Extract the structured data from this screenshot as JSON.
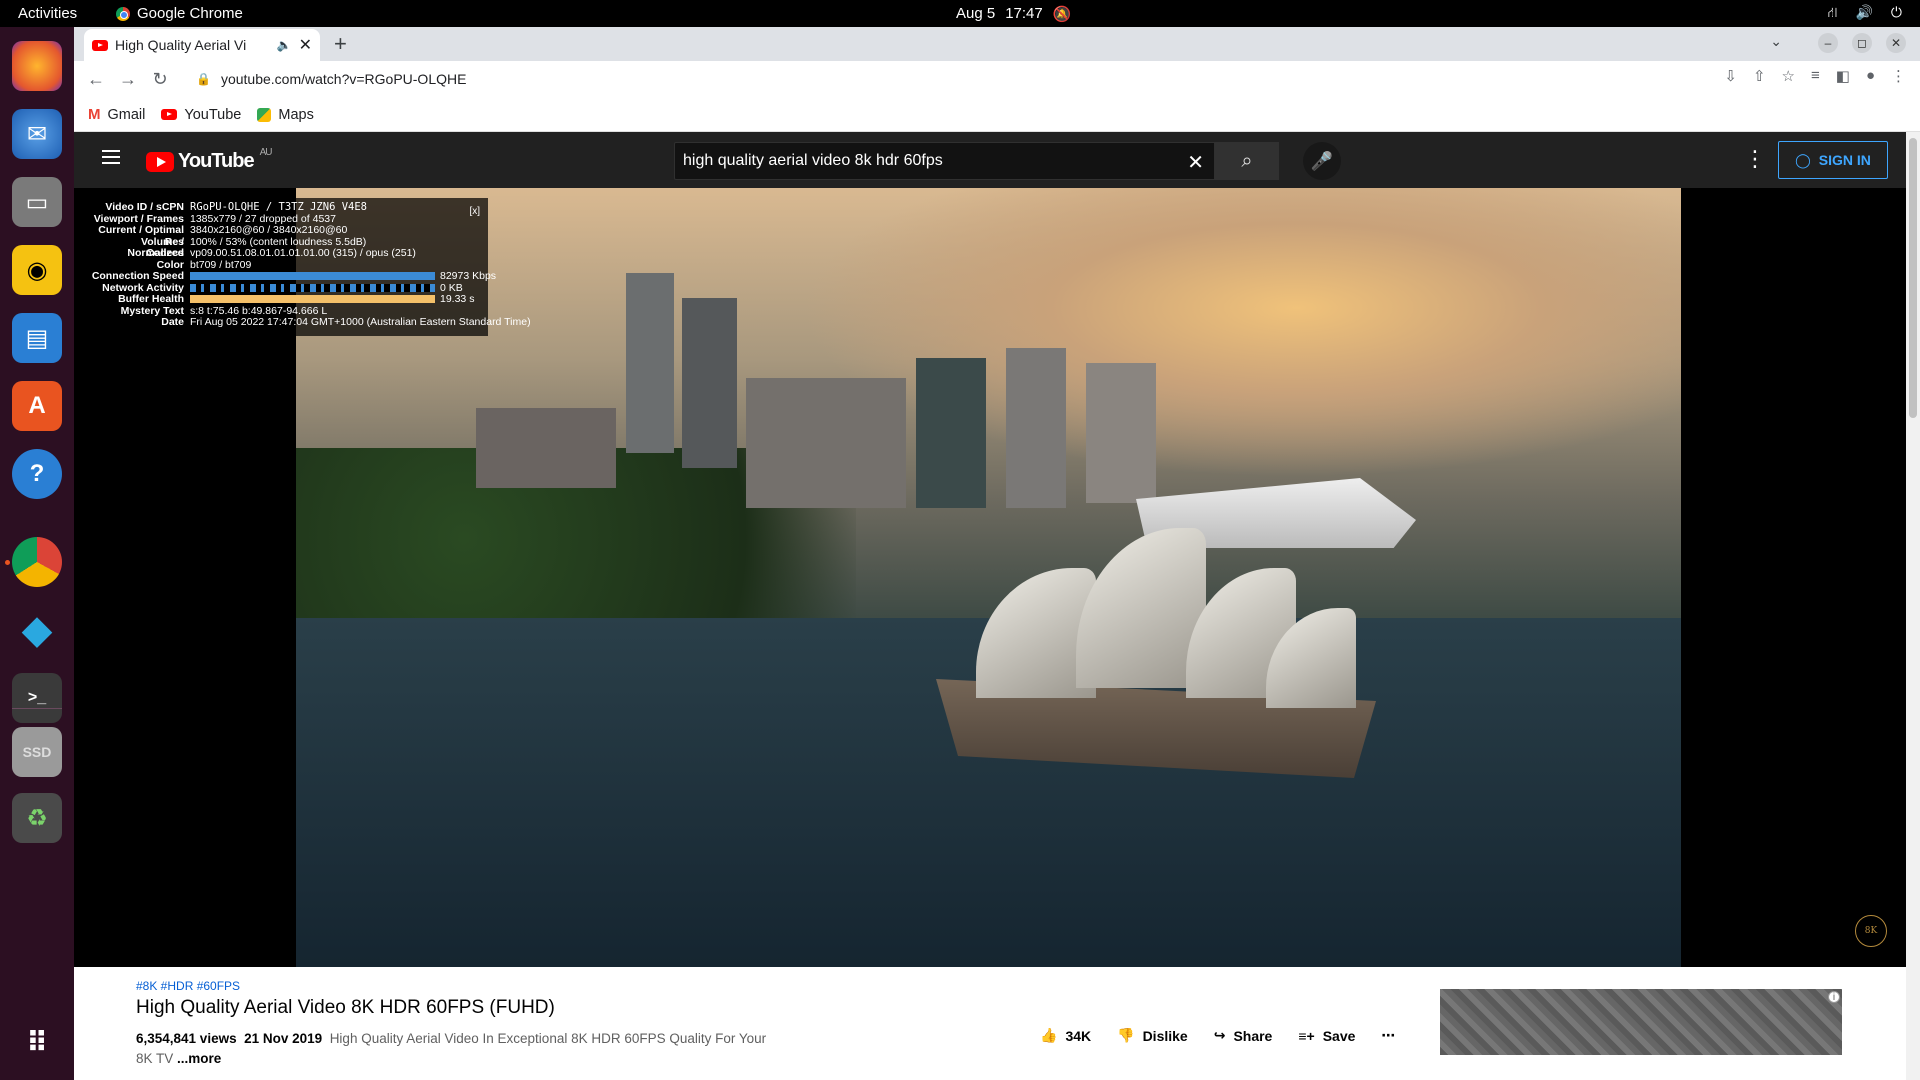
{
  "os": {
    "activities": "Activities",
    "active_app": "Google Chrome",
    "date": "Aug 5",
    "time": "17:47"
  },
  "browser": {
    "tab_title": "High Quality Aerial Vi",
    "url": "youtube.com/watch?v=RGoPU-OLQHE",
    "bookmarks": [
      "Gmail",
      "YouTube",
      "Maps"
    ]
  },
  "youtube": {
    "logo": "YouTube",
    "region": "AU",
    "search_query": "high quality aerial video 8k hdr 60fps",
    "sign_in": "SIGN IN"
  },
  "stats_for_nerds": {
    "close": "[x]",
    "rows": [
      {
        "label": "Video ID / sCPN",
        "value": "RGoPU-OLQHE / T3TZ JZN6 V4E8"
      },
      {
        "label": "Viewport / Frames",
        "value": "1385x779 / 27 dropped of 4537"
      },
      {
        "label": "Current / Optimal Res",
        "value": "3840x2160@60 / 3840x2160@60"
      },
      {
        "label": "Volume / Normalized",
        "value": "100% / 53% (content loudness 5.5dB)"
      },
      {
        "label": "Codecs",
        "value": "vp09.00.51.08.01.01.01.01.00 (315) / opus (251)"
      },
      {
        "label": "Color",
        "value": "bt709 / bt709"
      },
      {
        "label": "Connection Speed",
        "value": "82973 Kbps"
      },
      {
        "label": "Network Activity",
        "value": "0 KB"
      },
      {
        "label": "Buffer Health",
        "value": "19.33 s"
      },
      {
        "label": "Mystery Text",
        "value": "s:8 t:75.46 b:49.867-94.666 L"
      },
      {
        "label": "Date",
        "value": "Fri Aug 05 2022 17:47:04 GMT+1000 (Australian Eastern Standard Time)"
      }
    ]
  },
  "watermark": "8K",
  "video": {
    "hashtags": "#8K #HDR #60FPS",
    "title": "High Quality Aerial Video 8K HDR 60FPS (FUHD)",
    "views": "6,354,841 views",
    "date": "21 Nov 2019",
    "description": "High Quality Aerial Video In Exceptional 8K HDR 60FPS Quality For Your 8K TV",
    "more": "...more",
    "likes": "34K",
    "dislike": "Dislike",
    "share": "Share",
    "save": "Save"
  }
}
